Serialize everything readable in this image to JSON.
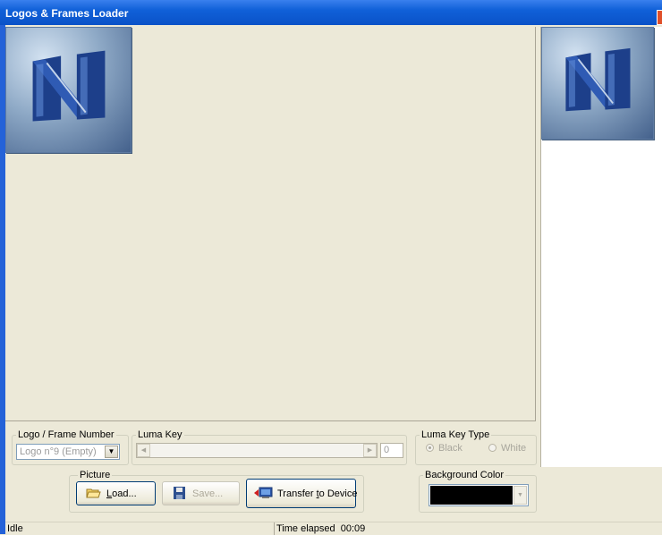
{
  "window": {
    "title": "Logos & Frames Loader"
  },
  "logo_frame": {
    "legend": "Logo / Frame Number",
    "selected": "Logo n°9 (Empty)"
  },
  "luma_key": {
    "legend": "Luma Key",
    "value": "0",
    "level": 0
  },
  "luma_key_type": {
    "legend": "Luma Key Type",
    "options": [
      "Black",
      "White"
    ],
    "selected": "Black"
  },
  "picture": {
    "legend": "Picture",
    "load_prefix": "",
    "load_key": "L",
    "load_rest": "oad...",
    "save_label": "Save...",
    "transfer_prefix": "Transfer ",
    "transfer_key": "t",
    "transfer_rest": "o Device"
  },
  "background_color": {
    "legend": "Background Color",
    "value": "#000000"
  },
  "status": {
    "state": "Idle",
    "elapsed_label": "Time elapsed",
    "elapsed": "00:09"
  },
  "icons": [
    "close-icon",
    "logo-image",
    "open-folder-icon",
    "floppy-disk-icon",
    "transfer-device-icon",
    "dropdown-arrow-icon",
    "scroll-left-icon",
    "scroll-right-icon"
  ]
}
